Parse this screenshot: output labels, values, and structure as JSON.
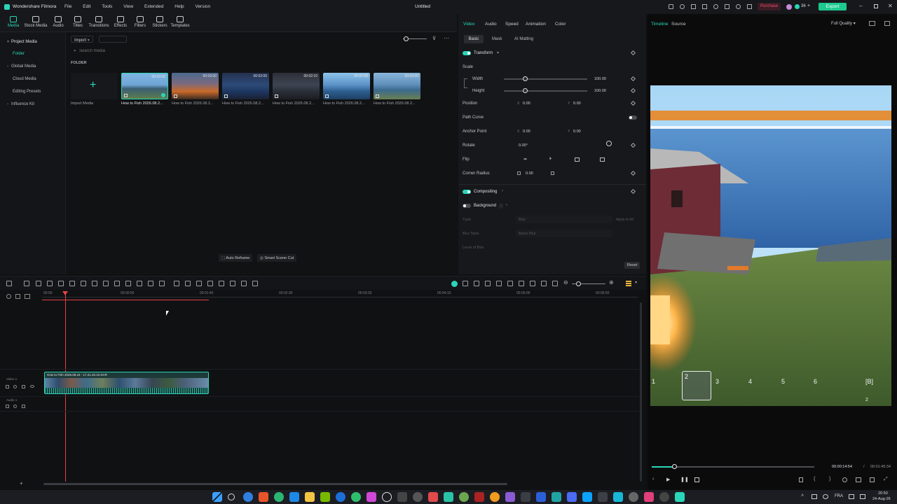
{
  "app": {
    "name": "Wondershare Filmora",
    "document_title": "Untitled",
    "menu": [
      "File",
      "Edit",
      "Tools",
      "View",
      "Extended",
      "Help",
      "Version"
    ],
    "purchase_label": "Purchase",
    "credits": "36",
    "export_label": "Export"
  },
  "media_tabs": [
    {
      "label": "Media",
      "icon": "media-icon",
      "active": true
    },
    {
      "label": "Stock Media",
      "icon": "stock-media-icon"
    },
    {
      "label": "Audio",
      "icon": "audio-icon"
    },
    {
      "label": "Titles",
      "icon": "titles-icon"
    },
    {
      "label": "Transitions",
      "icon": "transitions-icon"
    },
    {
      "label": "Effects",
      "icon": "effects-icon"
    },
    {
      "label": "Filters",
      "icon": "filters-icon"
    },
    {
      "label": "Stickers",
      "icon": "stickers-icon"
    },
    {
      "label": "Templates",
      "icon": "templates-icon"
    }
  ],
  "sidebar": {
    "items": [
      {
        "label": "Project Media",
        "expanded": true
      },
      {
        "label": "Folder",
        "selected": true
      },
      {
        "label": "Global Media"
      },
      {
        "label": "Cloud Media"
      },
      {
        "label": "Editing Presets"
      },
      {
        "label": "Influence Kit"
      }
    ]
  },
  "media": {
    "import_label": "Import",
    "search_placeholder": "Search media",
    "folder_heading": "FOLDER",
    "import_tile_label": "Import Media",
    "clips": [
      {
        "name": "How to Fish 2026.08.2...",
        "duration": "00:03:00",
        "selected": true
      },
      {
        "name": "How to Fish 2026.08.2...",
        "duration": "00:03:00"
      },
      {
        "name": "How to Fish 2026.08.2...",
        "duration": "00:02:00"
      },
      {
        "name": "How to Fish 2026.08.2...",
        "duration": "00:02:10"
      },
      {
        "name": "How to Fish 2026.08.2...",
        "duration": "00:02:58"
      },
      {
        "name": "How to Fish 2026.08.2...",
        "duration": "00:03:00"
      }
    ],
    "auto_reframe": "Auto Reframe",
    "smart_scene_cut": "Smart Scene Cut"
  },
  "properties": {
    "tabs": [
      "Video",
      "Audio",
      "Speed",
      "Animation",
      "Color"
    ],
    "active_tab": "Video",
    "subtabs": [
      "Basic",
      "Mask",
      "AI Matting"
    ],
    "transform_label": "Transform",
    "scale_label": "Scale",
    "width_label": "Width",
    "width_value": "100.00",
    "width_level": 0.25,
    "height_label": "Height",
    "height_value": "100.00",
    "height_level": 0.25,
    "position_label": "Position",
    "position_x": "0.00",
    "position_y": "0.00",
    "path_curve_label": "Path Curve",
    "anchor_label": "Anchor Point",
    "anchor_x": "0.00",
    "anchor_y": "0.00",
    "rotate_label": "Rotate",
    "rotate_value": "0.00°",
    "flip_label": "Flip",
    "corner_label": "Corner Radius",
    "corner_value": "0.00",
    "compositing_label": "Compositing",
    "background_label": "Background",
    "type_label": "Type",
    "type_value": "Blur",
    "apply_all": "Apply to All",
    "blur_style_label": "Blur Style",
    "blur_style_value": "Basic Blur",
    "level_label": "Level of Blur",
    "reset_label": "Reset"
  },
  "preview": {
    "tabs": [
      "Timeline",
      "Source"
    ],
    "active_tab": "Timeline",
    "quality": "Full Quality",
    "current_time": "00:00:14:54",
    "separator": "/",
    "total_time": "00:01:45:34",
    "progress": 0.14,
    "hotbar": [
      "1",
      "2",
      "3",
      "4",
      "5",
      "6"
    ],
    "hotbar_key": "[B]",
    "hotbar_count": "2"
  },
  "timeline": {
    "ruler": [
      "00:00",
      "00:00:50",
      "00:01:40",
      "00:02:30",
      "00:03:20",
      "00:04:10",
      "00:05:00",
      "00:05:50"
    ],
    "video_track": "Video 1",
    "audio_track": "Audio 1",
    "clip_label": "How to Fish 2026.08.24 - 17.21.40.10.DVR"
  },
  "taskbar": {
    "language": "FRA",
    "time": "20:50",
    "date": "24-Aug-26"
  },
  "colors": {
    "accent": "#2ad6b9",
    "purchase": "#e8506e",
    "export": "#1ec98f",
    "playhead": "#e54343"
  }
}
